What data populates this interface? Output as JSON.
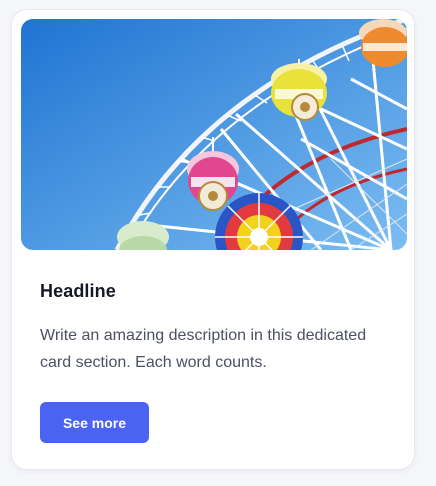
{
  "card": {
    "image": {
      "subject": "ferris-wheel",
      "colors": {
        "sky_top": "#2a7fd8",
        "sky_bottom": "#6db3ef",
        "frame": "#ffffff",
        "rim_red": "#c0282e",
        "gondola_pink": "#e0478e",
        "gondola_yellow": "#e9e23a",
        "gondola_orange": "#ef8a2e",
        "gondola_green": "#b8d9a6",
        "hub_blue": "#2a55c7",
        "hub_yellow": "#f3d21d"
      }
    },
    "headline": "Headline",
    "description": "Write an amazing description in this dedicated card section. Each word counts.",
    "button_label": "See more"
  },
  "theme": {
    "accent": "#4a63f2",
    "background": "#f5f6fa",
    "card_background": "#ffffff",
    "heading_color": "#161a25",
    "text_color": "#4b5162"
  }
}
